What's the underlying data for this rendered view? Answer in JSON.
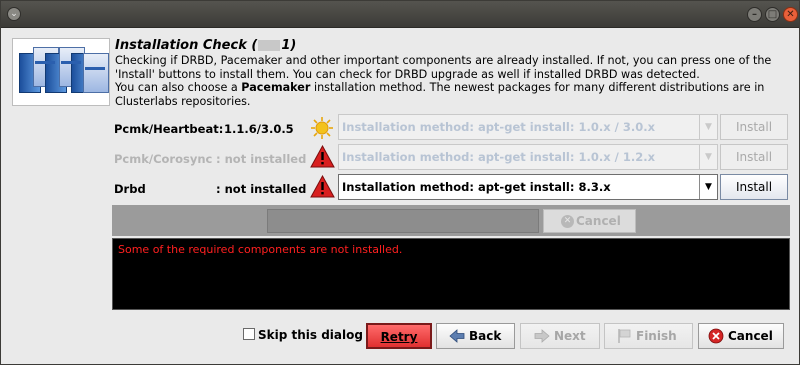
{
  "window": {
    "menu_glyph": "⌄",
    "minimize_glyph": "–",
    "maximize_glyph": "□",
    "close_glyph": "✕"
  },
  "header": {
    "title_before": "Installation Check (",
    "title_after": "1)",
    "line1": "Checking if DRBD, Pacemaker and other important components are already installed. If not, you can press one of the",
    "line2": "'Install' buttons to install them. You can check for DRBD upgrade as well if installed DRBD was detected.",
    "line3_before": "You can also choose a ",
    "line3_bold": "Pacemaker",
    "line3_after": " installation method. The newest packages for many different distributions are in",
    "line4": "Clusterlabs repositories."
  },
  "rows": [
    {
      "label": "Pcmk/Heartbeat:",
      "status": "1.1.6/3.0.5",
      "icon": "sun-icon",
      "method": "Installation method: apt-get install: 1.0.x / 3.0.x",
      "install": "Install",
      "enabled": false
    },
    {
      "label": "Pcmk/Corosync",
      "status": ": not installed",
      "icon": "warning-icon",
      "method": "Installation method: apt-get install: 1.0.x / 1.2.x",
      "install": "Install",
      "enabled": false
    },
    {
      "label": "Drbd",
      "status": ": not installed",
      "icon": "warning-icon",
      "method": "Installation method: apt-get install: 8.3.x",
      "install": "Install",
      "enabled": true
    }
  ],
  "progress": {
    "cancel_label": "Cancel"
  },
  "console": {
    "message": "Some of the required components are not installed."
  },
  "footer": {
    "skip_label": "Skip this dialog",
    "retry": "Retry",
    "back": "Back",
    "next": "Next",
    "finish": "Finish",
    "cancel": "Cancel"
  },
  "colors": {
    "console_text": "#ff2020",
    "retry_bg": "#e03030",
    "warning": "#d81f1f",
    "sun": "#f3c21b"
  }
}
